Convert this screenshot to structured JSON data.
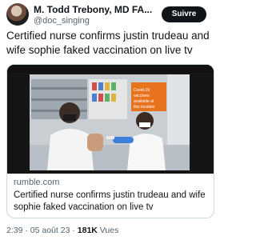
{
  "author": {
    "display_name": "M. Todd Trebony, MD FA...",
    "handle": "@doc_singing",
    "follow_label": "Suivre"
  },
  "tweet": {
    "text": "Certified nurse confirms justin trudeau and wife sophie faked vaccination on live tv"
  },
  "card": {
    "domain": "rumble.com",
    "title": "Certified nurse confirms justin trudeau and wife sophie faked vaccination on live tv",
    "video_sign_text": "Covid-19 vaccines available at this location"
  },
  "meta": {
    "time": "2:39",
    "sep1": "·",
    "date": "05 août 23",
    "sep2": "·",
    "views_count": "181K",
    "views_label": "Vues"
  }
}
